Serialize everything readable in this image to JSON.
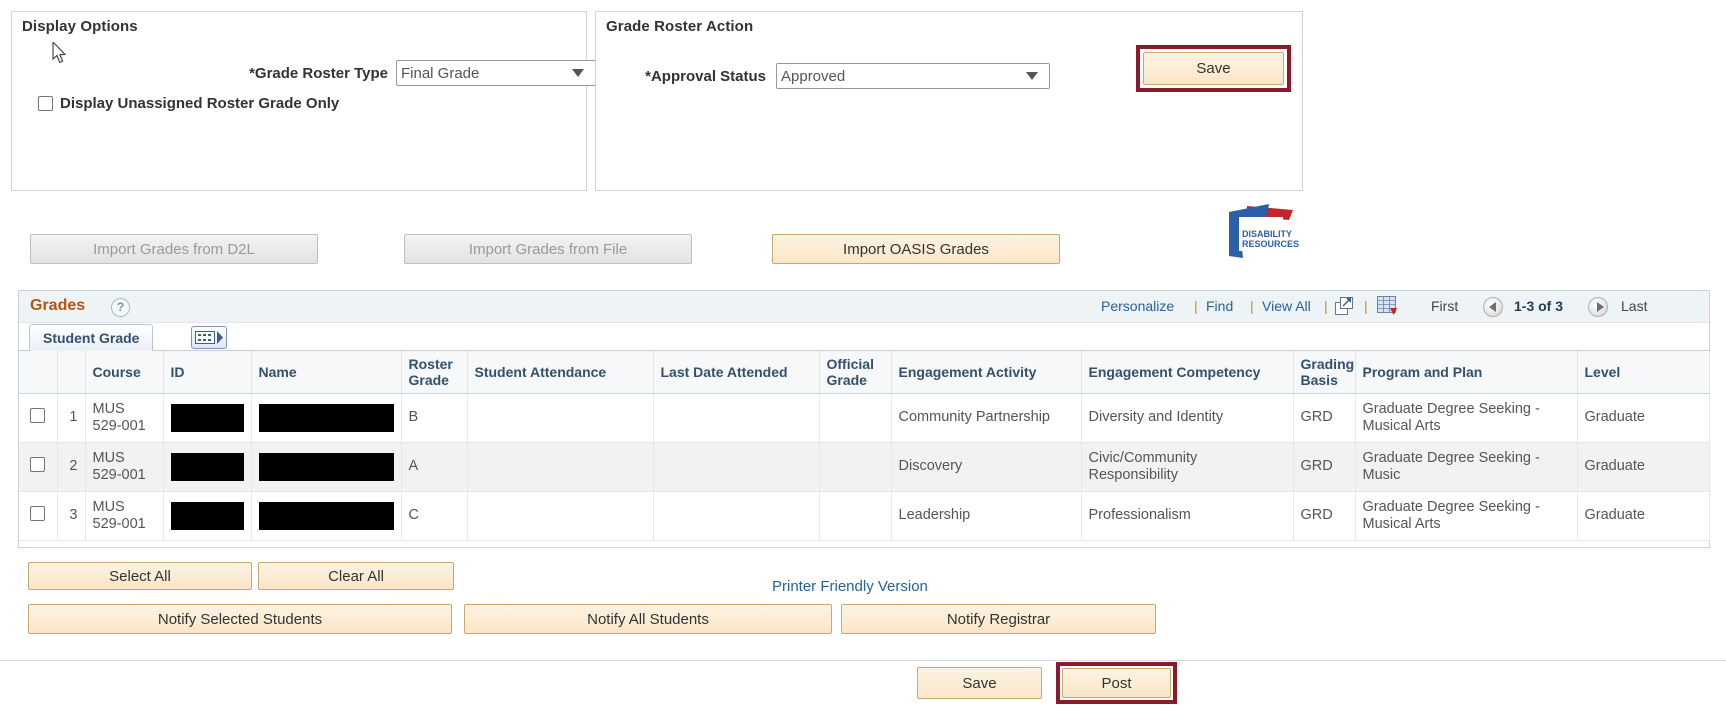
{
  "display_options": {
    "title": "Display Options",
    "grade_roster_type_label": "*Grade Roster Type",
    "grade_roster_type_value": "Final Grade",
    "grade_roster_type_options": [
      "Final Grade"
    ],
    "unassigned_checkbox_label": "Display Unassigned Roster Grade Only",
    "unassigned_checked": false
  },
  "roster_action": {
    "title": "Grade Roster Action",
    "approval_status_label": "*Approval Status",
    "approval_status_value": "Approved",
    "approval_status_options": [
      "Approved"
    ],
    "save_label": "Save",
    "save_highlight_color": "#8b1a2b"
  },
  "import_bar": {
    "d2l_label": "Import Grades from D2L",
    "d2l_enabled": false,
    "file_label": "Import Grades from File",
    "file_enabled": false,
    "oasis_label": "Import OASIS Grades",
    "oasis_enabled": true,
    "logo_line1": "DISABILITY",
    "logo_line2": "RESOURCES",
    "logo_blue": "#2b5fa8",
    "logo_red": "#c0272d"
  },
  "grades": {
    "title": "Grades",
    "help_icon": "?",
    "toolbar": {
      "personalize": "Personalize",
      "find": "Find",
      "view_all": "View All",
      "separator": "|",
      "expand_icon": "expand-icon",
      "download_icon": "download-spreadsheet-icon",
      "first": "First",
      "range": "1-3 of 3",
      "last": "Last"
    },
    "tab_label": "Student Grade",
    "columns": [
      "",
      "",
      "Course",
      "ID",
      "Name",
      "Roster Grade",
      "Student Attendance",
      "Last Date Attended",
      "Official Grade",
      "Engagement Activity",
      "Engagement Competency",
      "Grading Basis",
      "Program and Plan",
      "Level"
    ],
    "rows": [
      {
        "selected": false,
        "num": "1",
        "course": "MUS 529-001",
        "id": "",
        "name": "",
        "roster_grade": "B",
        "student_attendance": "",
        "last_date_attended": "",
        "official_grade": "",
        "engagement_activity": "Community Partnership",
        "engagement_competency": "Diversity and Identity",
        "grading_basis": "GRD",
        "program_and_plan": "Graduate Degree Seeking - Musical Arts",
        "level": "Graduate"
      },
      {
        "selected": false,
        "num": "2",
        "course": "MUS 529-001",
        "id": "",
        "name": "",
        "roster_grade": "A",
        "student_attendance": "",
        "last_date_attended": "",
        "official_grade": "",
        "engagement_activity": "Discovery",
        "engagement_competency": "Civic/Community Responsibility",
        "grading_basis": "GRD",
        "program_and_plan": "Graduate Degree Seeking - Music",
        "level": "Graduate"
      },
      {
        "selected": false,
        "num": "3",
        "course": "MUS 529-001",
        "id": "",
        "name": "",
        "roster_grade": "C",
        "student_attendance": "",
        "last_date_attended": "",
        "official_grade": "",
        "engagement_activity": "Leadership",
        "engagement_competency": "Professionalism",
        "grading_basis": "GRD",
        "program_and_plan": "Graduate Degree Seeking - Musical Arts",
        "level": "Graduate"
      }
    ]
  },
  "actions": {
    "select_all": "Select All",
    "clear_all": "Clear All",
    "notify_selected": "Notify Selected Students",
    "notify_all": "Notify All Students",
    "notify_registrar": "Notify Registrar",
    "printer_friendly": "Printer Friendly Version",
    "save": "Save",
    "post": "Post",
    "post_highlight_color": "#8b1a2b"
  }
}
